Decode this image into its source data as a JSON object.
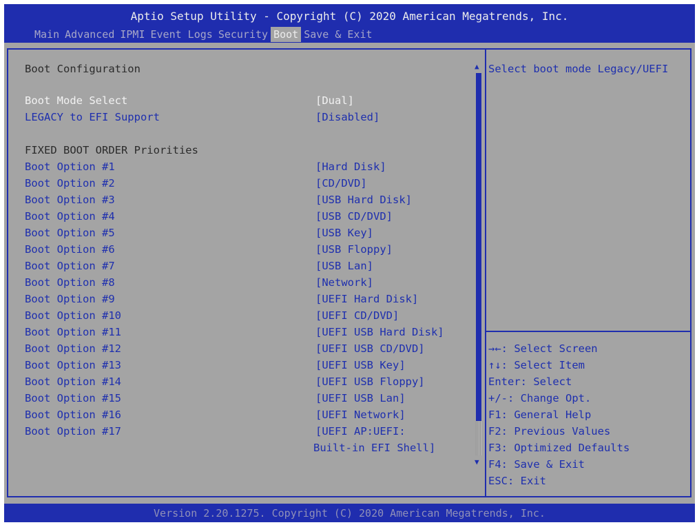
{
  "header": {
    "title": "Aptio Setup Utility - Copyright (C) 2020 American Megatrends, Inc.",
    "tabs": [
      "Main",
      "Advanced",
      "IPMI",
      "Event Logs",
      "Security",
      "Boot",
      "Save & Exit"
    ],
    "active_tab": "Boot"
  },
  "main": {
    "section_title": "Boot Configuration",
    "boot_mode": {
      "label": "Boot Mode Select",
      "value": "[Dual]"
    },
    "legacy_efi": {
      "label": "LEGACY to EFI Support",
      "value": "[Disabled]"
    },
    "priorities_title": "FIXED BOOT ORDER Priorities",
    "options": [
      {
        "label": "Boot Option #1",
        "value": "[Hard Disk]"
      },
      {
        "label": "Boot Option #2",
        "value": "[CD/DVD]"
      },
      {
        "label": "Boot Option #3",
        "value": "[USB Hard Disk]"
      },
      {
        "label": "Boot Option #4",
        "value": "[USB CD/DVD]"
      },
      {
        "label": "Boot Option #5",
        "value": "[USB Key]"
      },
      {
        "label": "Boot Option #6",
        "value": "[USB Floppy]"
      },
      {
        "label": "Boot Option #7",
        "value": "[USB Lan]"
      },
      {
        "label": "Boot Option #8",
        "value": "[Network]"
      },
      {
        "label": "Boot Option #9",
        "value": "[UEFI Hard Disk]"
      },
      {
        "label": "Boot Option #10",
        "value": "[UEFI CD/DVD]"
      },
      {
        "label": "Boot Option #11",
        "value": "[UEFI USB Hard Disk]"
      },
      {
        "label": "Boot Option #12",
        "value": "[UEFI USB CD/DVD]"
      },
      {
        "label": "Boot Option #13",
        "value": "[UEFI USB Key]"
      },
      {
        "label": "Boot Option #14",
        "value": "[UEFI USB Floppy]"
      },
      {
        "label": "Boot Option #15",
        "value": "[UEFI USB Lan]"
      },
      {
        "label": "Boot Option #16",
        "value": "[UEFI Network]"
      },
      {
        "label": "Boot Option #17",
        "value": "[UEFI AP:UEFI:",
        "value_line2": "Built-in EFI Shell]"
      }
    ]
  },
  "help": {
    "text": "Select boot mode Legacy/UEFI",
    "keys": [
      "→←: Select Screen",
      "↑↓: Select Item",
      "Enter: Select",
      "+/-: Change Opt.",
      "F1: General Help",
      "F2: Previous Values",
      "F3: Optimized Defaults",
      "F4: Save & Exit",
      "ESC: Exit"
    ]
  },
  "footer": {
    "text": "Version 2.20.1275. Copyright (C) 2020 American Megatrends, Inc."
  },
  "colors": {
    "bar_blue": "#1f2dae",
    "panel_gray": "#a4a4a4",
    "item_blue": "#1e2fae",
    "selected_white": "#f2f2f2"
  },
  "icons": {
    "scroll_up": "▲",
    "scroll_down": "▼"
  }
}
